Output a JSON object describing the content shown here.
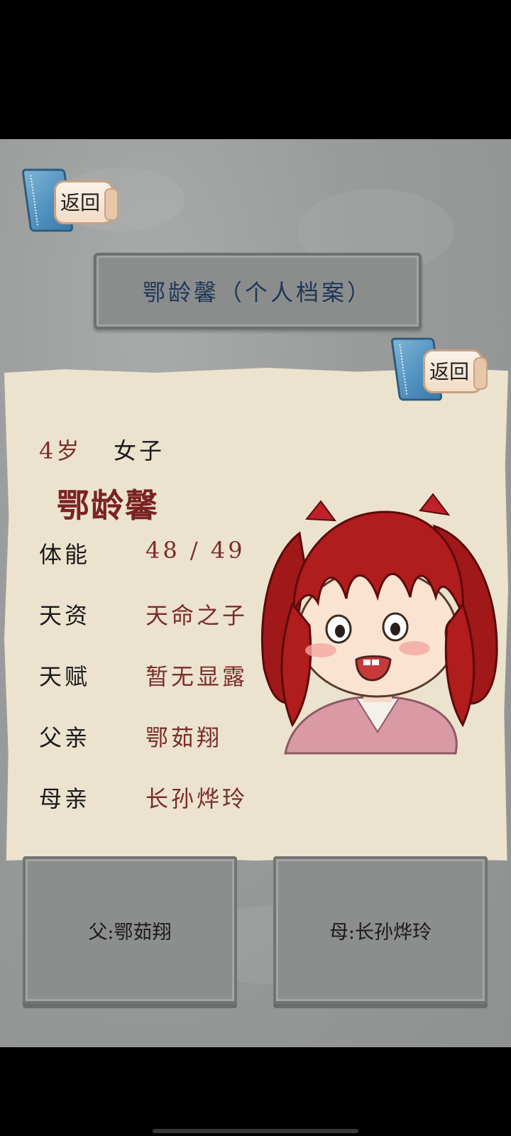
{
  "header": {
    "back_label": "返回",
    "title": "鄂龄馨（个人档案）"
  },
  "profile": {
    "back_label": "返回",
    "age": "4岁",
    "gender": "女子",
    "name": "鄂龄馨",
    "rows": [
      {
        "label": "体能",
        "value": "48 / 49"
      },
      {
        "label": "天资",
        "value": "天命之子"
      },
      {
        "label": "天赋",
        "value": "暂无显露"
      },
      {
        "label": "父亲",
        "value": "鄂茹翔"
      },
      {
        "label": "母亲",
        "value": "长孙烨玲"
      }
    ]
  },
  "parents": {
    "father_button": "父:鄂茹翔",
    "mother_button": "母:长孙烨玲"
  },
  "colors": {
    "stone_bg": "#9a9c9c",
    "paper": "#ece3cf",
    "name_red": "#7a2323",
    "title_blue": "#1f3656"
  },
  "icons": {
    "back": "book-scroll-icon",
    "portrait": "girl-portrait"
  }
}
